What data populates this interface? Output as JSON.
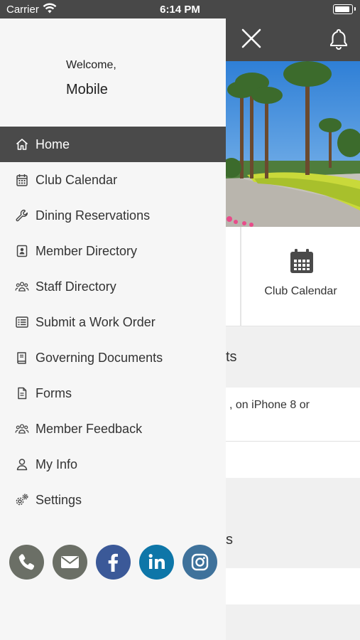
{
  "status_bar": {
    "carrier": "Carrier",
    "time": "6:14 PM"
  },
  "drawer": {
    "welcome": "Welcome,",
    "user_name": "Mobile",
    "menu": [
      {
        "label": "Home",
        "icon": "home-icon",
        "active": true
      },
      {
        "label": "Club Calendar",
        "icon": "calendar-icon"
      },
      {
        "label": "Dining Reservations",
        "icon": "wrench-icon"
      },
      {
        "label": "Member Directory",
        "icon": "contact-book-icon"
      },
      {
        "label": "Staff Directory",
        "icon": "people-icon"
      },
      {
        "label": "Submit a Work Order",
        "icon": "list-icon"
      },
      {
        "label": "Governing Documents",
        "icon": "book-icon"
      },
      {
        "label": "Forms",
        "icon": "document-icon"
      },
      {
        "label": "Member Feedback",
        "icon": "people-icon"
      },
      {
        "label": "My Info",
        "icon": "user-icon"
      },
      {
        "label": "Settings",
        "icon": "gears-icon"
      }
    ],
    "social": [
      {
        "name": "phone-icon",
        "color": "#6b6f66"
      },
      {
        "name": "email-icon",
        "color": "#6b6f66"
      },
      {
        "name": "facebook-icon",
        "color": "#3b5998"
      },
      {
        "name": "linkedin-icon",
        "color": "#0e76a8"
      },
      {
        "name": "instagram-icon",
        "color": "#3f729b"
      }
    ]
  },
  "background": {
    "tile_label": "Club Calendar",
    "fragment_1": "ts",
    "fragment_2": ", on iPhone 8 or",
    "fragment_3": "s"
  },
  "colors": {
    "header": "#484848",
    "active_item": "#4a4a4a",
    "drawer_bg": "#f6f6f6"
  }
}
